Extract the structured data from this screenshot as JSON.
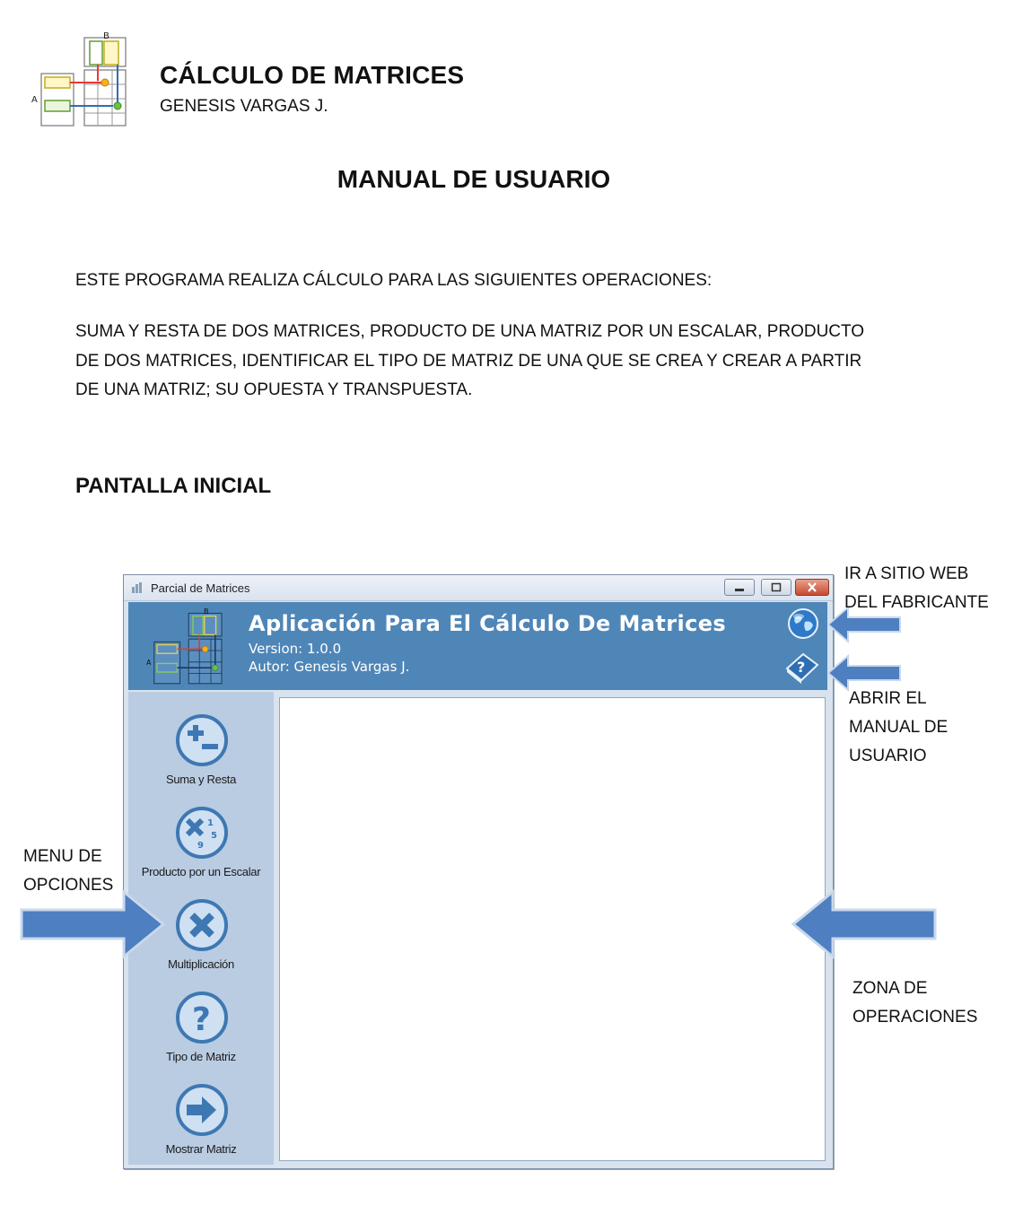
{
  "document": {
    "title": "CÁLCULO DE MATRICES",
    "author": "GENESIS VARGAS J.",
    "manual_title": "MANUAL DE USUARIO",
    "intro": "ESTE PROGRAMA REALIZA CÁLCULO PARA LAS SIGUIENTES OPERACIONES:",
    "paragraph_lines": [
      "SUMA Y RESTA DE DOS MATRICES, PRODUCTO DE UNA MATRIZ POR UN ESCALAR, PRODUCTO",
      "DE DOS MATRICES, IDENTIFICAR EL TIPO DE MATRIZ DE UNA QUE SE CREA Y CREAR A PARTIR",
      "DE UNA MATRIZ; SU OPUESTA Y TRANSPUESTA."
    ],
    "section_title": "PANTALLA INICIAL",
    "logo_labels": {
      "a": "A",
      "b": "B"
    }
  },
  "app": {
    "window_title": "Parcial de Matrices",
    "banner_title": "Aplicación Para El Cálculo De Matrices",
    "version": "Version: 1.0.0",
    "author": "Autor: Genesis Vargas J.",
    "menu": [
      {
        "label": "Suma y Resta",
        "icon": "plus-minus-icon"
      },
      {
        "label": "Producto por un Escalar",
        "icon": "scalar-product-icon"
      },
      {
        "label": "Multiplicación",
        "icon": "multiply-icon"
      },
      {
        "label": "Tipo de Matriz",
        "icon": "question-icon"
      },
      {
        "label": "Mostrar Matriz",
        "icon": "arrow-right-icon"
      }
    ],
    "colors": {
      "banner": "#4f86b8",
      "sidebar": "#b9cce2",
      "icon_blue": "#3e78b3"
    }
  },
  "annotations": {
    "web": [
      "IR A SITIO WEB",
      "DEL FABRICANTE"
    ],
    "manual": [
      "ABRIR EL",
      "MANUAL DE",
      "USUARIO"
    ],
    "menu": [
      "MENU DE",
      "OPCIONES"
    ],
    "zone": [
      "ZONA DE",
      "OPERACIONES"
    ]
  }
}
